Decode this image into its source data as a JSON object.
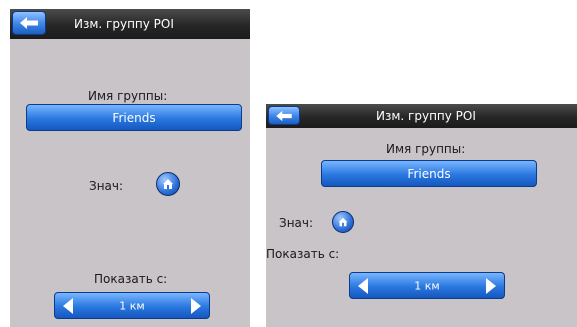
{
  "screens": [
    {
      "title": "Изм. группу POI",
      "group_name_label": "Имя группы:",
      "group_name_value": "Friends",
      "icon_label": "Знач:",
      "show_from_label": "Показать с:",
      "show_from_value": "1 км"
    },
    {
      "title": "Изм. группу POI",
      "group_name_label": "Имя группы:",
      "group_name_value": "Friends",
      "icon_label": "Знач:",
      "show_from_label": "Показать с:",
      "show_from_value": "1 км"
    }
  ],
  "colors": {
    "accent": "#2a78e0",
    "titlebar": "#262626",
    "panel": "#c8c4c8"
  },
  "icons": {
    "back": "left-arrow-icon",
    "poi": "house-pin-icon"
  }
}
